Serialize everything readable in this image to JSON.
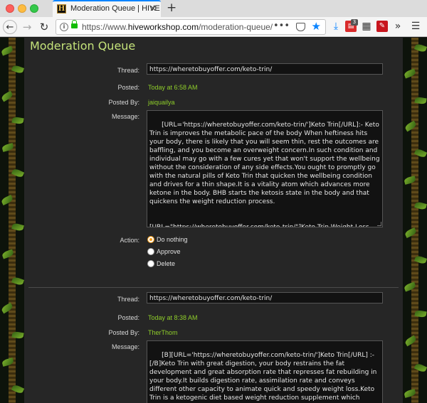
{
  "browser": {
    "tab_title": "Moderation Queue | HIVE",
    "tab_favicon": "H",
    "url_prefix": "https://www.",
    "url_domain": "hiveworkshop.com",
    "url_path": "/moderation-queue/",
    "ext_badge": "3"
  },
  "page": {
    "title": "Moderation Queue"
  },
  "labels": {
    "thread": "Thread:",
    "posted": "Posted:",
    "posted_by": "Posted By:",
    "message": "Message:",
    "action": "Action:"
  },
  "actions": {
    "do_nothing": "Do nothing",
    "approve": "Approve",
    "delete": "Delete"
  },
  "items": [
    {
      "thread_url": "https://wheretobuyoffer.com/keto-trin/",
      "posted": "Today at 6:58 AM",
      "posted_by": "jaiquailya",
      "message": "[URL='https://wheretobuyoffer.com/keto-trin/']Keto Trin[/URL]:- Keto Trin is improves the metabolic pace of the body When heftiness hits your body, there is likely that you will seem thin, rest the outcomes are baffling, and you become an overweight concern.In such condition and individual may go with a few cures yet that won't support the wellbeing without the consideration of any side effects.You ought to promptly go with the natural pills of Keto Trin that quicken the wellbeing condition and drives for a thin shape.It is a vitality atom which advances more ketone in the body. BHB starts the ketosis state in the body and that quickens the weight reduction process.\n\n\n[URL=\"https://wheretobuyoffer.com/keto-trin/\"]Keto Trin Weight Loss Pills Review, Ingredients - Where To Buy?[/URL]",
      "selected_action": "do_nothing"
    },
    {
      "thread_url": "https://wheretobuyoffer.com/keto-trin/",
      "posted": "Today at 8:38 AM",
      "posted_by": "TherThom",
      "message": "[B][URL='https://wheretobuyoffer.com/keto-trin/']Keto Trin[/URL] :- [/B]Keto Trin with great digestion, your body restrains the fat development and great absorption rate that represses fat rebuilding in your body.It builds digestion rate, assimilation rate and conveys different other capacity to animate quick and speedy weight loss.Keto Trin is a ketogenic diet based weight reduction supplement which primary key fixings are BHB ketones."
    }
  ],
  "colors": {
    "accent_green": "#8fce2a",
    "title_green": "#c4e27a",
    "radio_selected": "#f29b1a"
  }
}
